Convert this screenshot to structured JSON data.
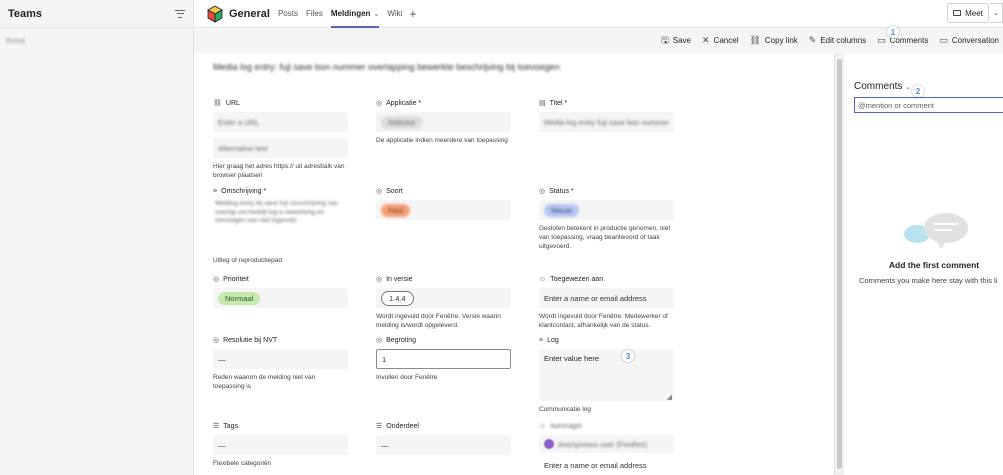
{
  "sidebar": {
    "title": "Teams",
    "item": "Rvsnjl"
  },
  "topbar": {
    "channel": "General",
    "tabs": [
      "Posts",
      "Files",
      "Meldingen",
      "Wiki"
    ],
    "meet_label": "Meet"
  },
  "commands": {
    "save": "Save",
    "cancel": "Cancel",
    "copy_link": "Copy link",
    "edit_columns": "Edit columns",
    "comments": "Comments",
    "conversation": "Conversation"
  },
  "form": {
    "title": "Media log entry: fuji save bon nummer overlapping bewerkte beschrijving bij toevoegen",
    "url": {
      "label": "URL",
      "value": "Enter a URL",
      "value2": "Alternative text",
      "desc": "Hier graag het adres https:// uit adresbalk van browser plaatsen"
    },
    "applicatie": {
      "label": "Applicatie *",
      "value": "Selector",
      "desc": "De applicatie indien meerdere van toepassing"
    },
    "titel": {
      "label": "Titel *",
      "value": "Media log entry fuji save bon nummer"
    },
    "omschrijving": {
      "label": "Omschrijving *",
      "value": "Melding entry bij save fuji omschrijving van overlap ont bedrijf log is bewerking en toevoegen van niet ingevuld",
      "desc": "Uitleg of reproductiepad"
    },
    "soort": {
      "label": "Soort",
      "value": "Fout"
    },
    "status": {
      "label": "Status *",
      "value": "Nieuw",
      "desc": "Gesloten betekent in productie genomen, niet van toepassing, vraag beantwoord of taak uitgevoerd."
    },
    "prioriteit": {
      "label": "Prioriteit",
      "value": "Normaal"
    },
    "in_versie": {
      "label": "In versie",
      "value": "1.4.4",
      "desc": "Wordt ingevuld door Fenêtre. Versie waarin melding is/wordt opgeleverd."
    },
    "toegewezen": {
      "label": "Toegewezen aan",
      "placeholder": "Enter a name or email address",
      "desc": "Wordt ingevuld door Fenêtre. Medewerker of klantcontact, afhankelijk van de status."
    },
    "resolutie": {
      "label": "Resolutie bij NVT",
      "value": "—",
      "desc": "Reden waarom de melding niet van toepassing is"
    },
    "begroting": {
      "label": "Begroting",
      "value": "1",
      "desc": "Invullen door Fenêtre"
    },
    "log": {
      "label": "Log",
      "placeholder": "Enter value here",
      "desc": "Communicatie log"
    },
    "tags": {
      "label": "Tags",
      "value": "—",
      "desc": "Flexibele categoriën"
    },
    "onderdeel": {
      "label": "Onderdeel",
      "value": "—"
    },
    "person": {
      "label": "Aanvrager",
      "name": "Anonymous user (Fenêtre)",
      "placeholder": "Enter a name or email address"
    }
  },
  "comments": {
    "title": "Comments",
    "input_placeholder": "@mention or comment",
    "empty_title": "Add the first comment",
    "empty_sub": "Comments you make here stay with this li"
  },
  "badges": [
    "1",
    "2",
    "3"
  ],
  "colors": {
    "accent": "#5b5fc7",
    "soort_pill": "#f4a07a",
    "status_pill": "#b7c6f0",
    "prioriteit_pill": "#c6e9b0"
  }
}
